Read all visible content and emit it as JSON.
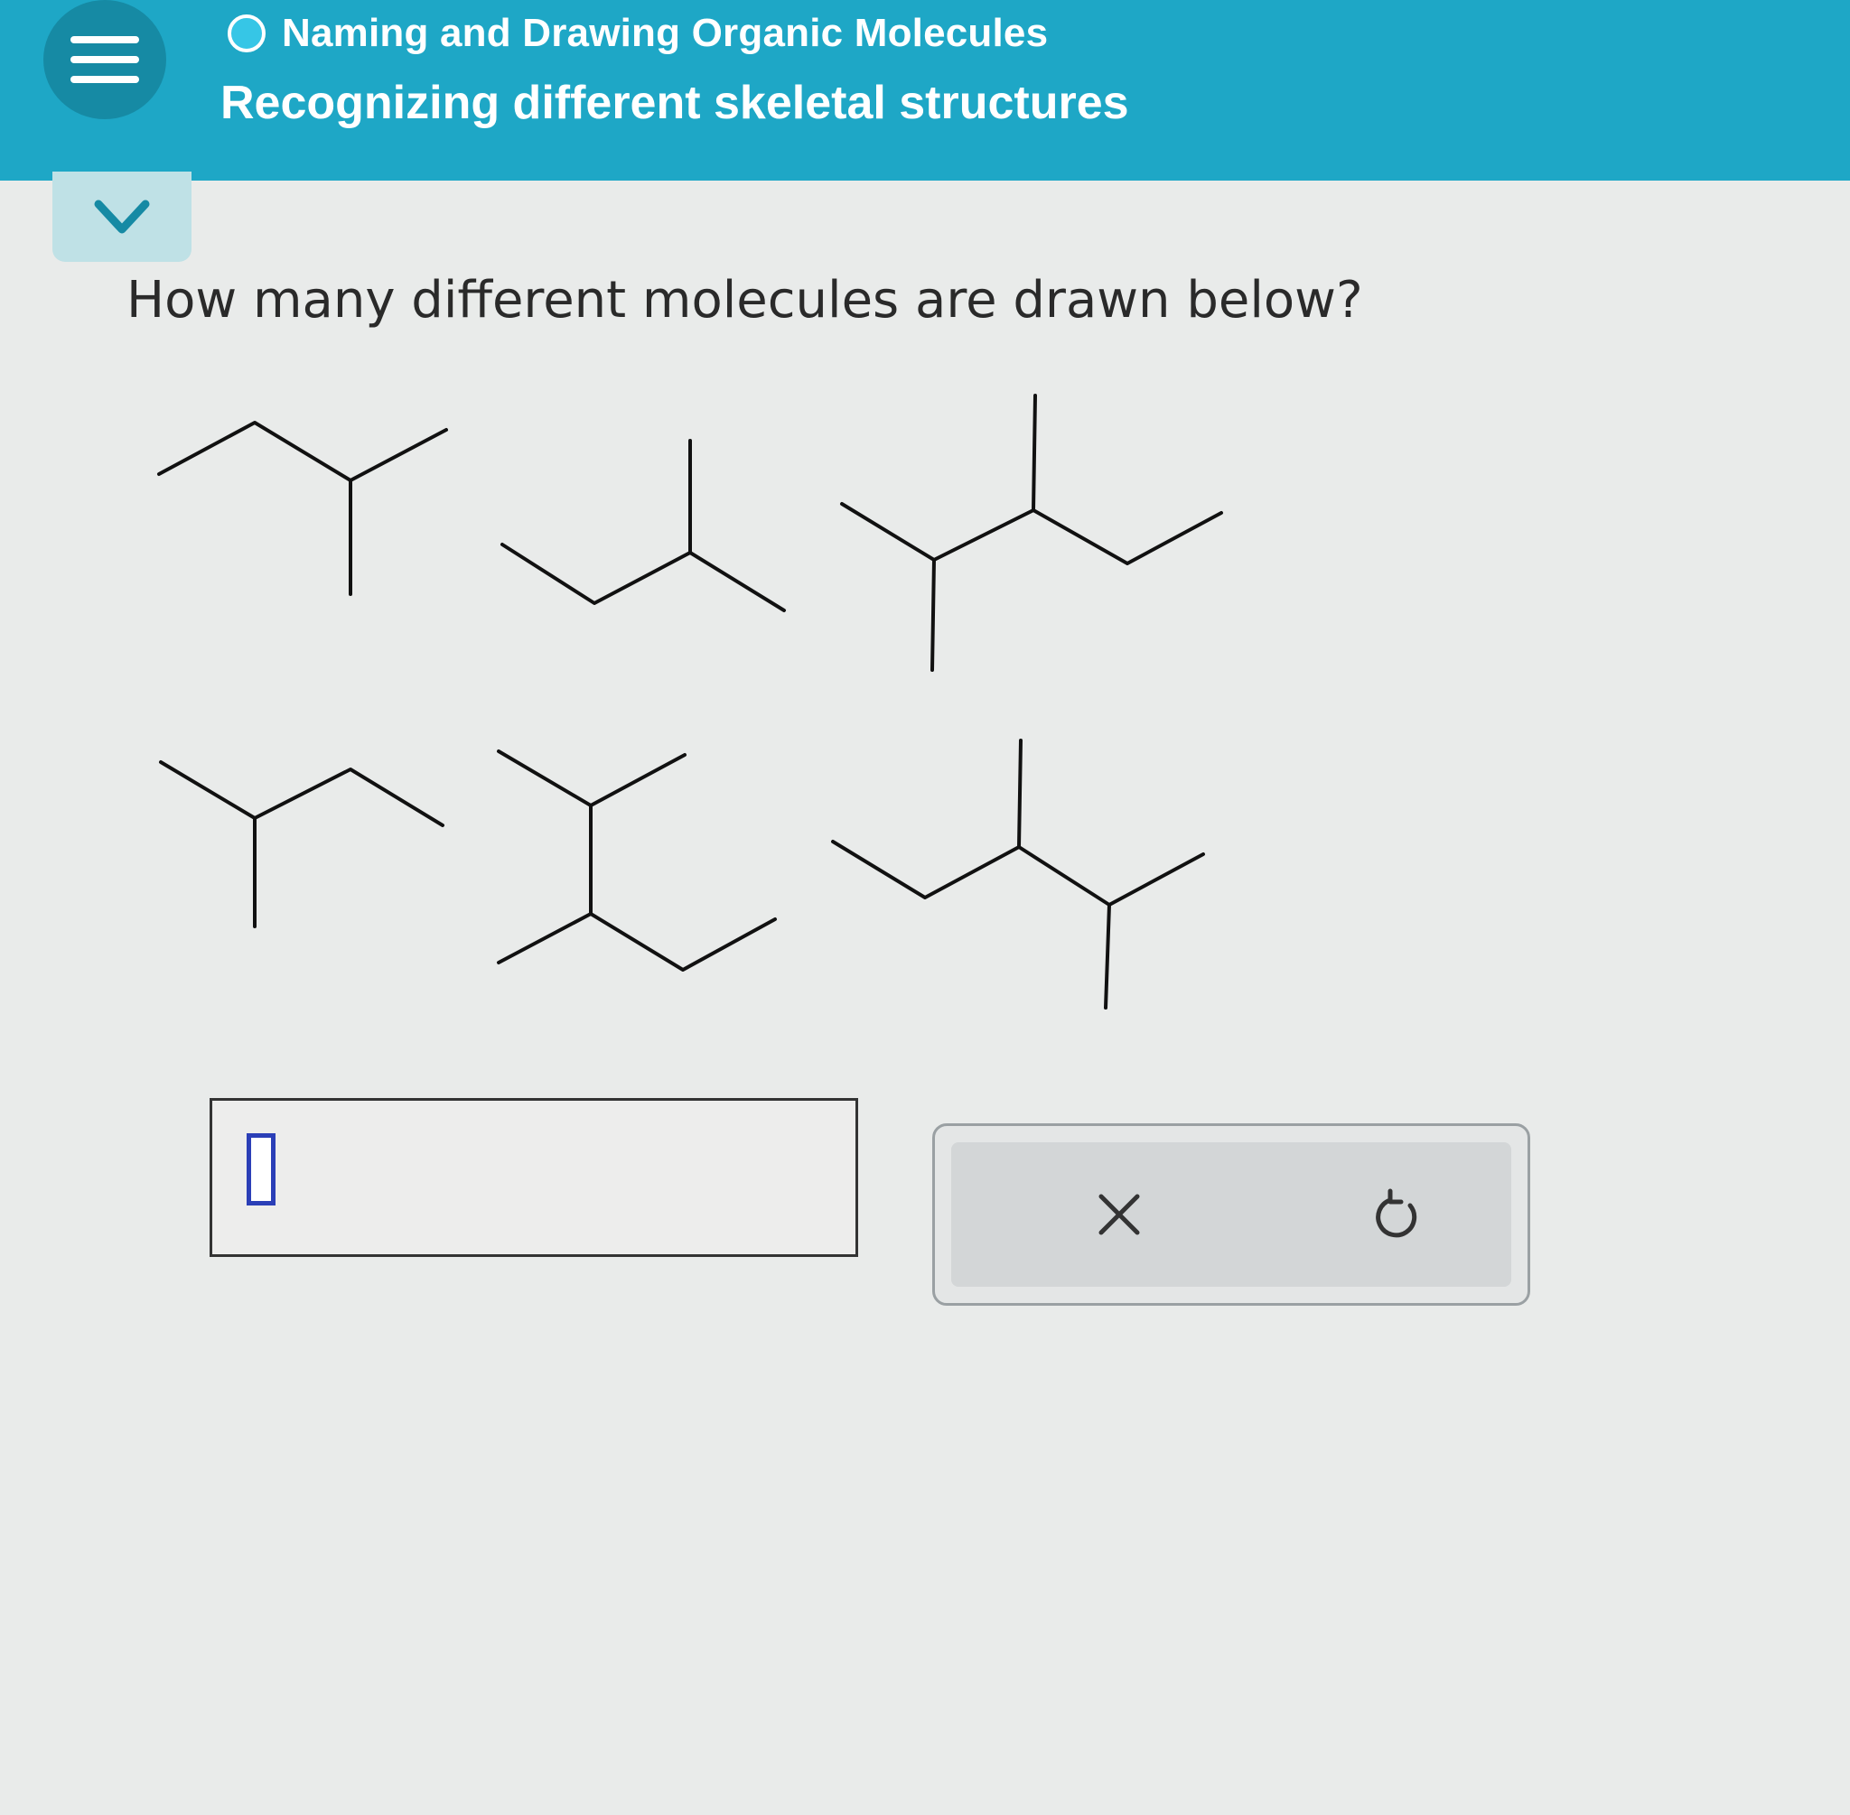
{
  "header": {
    "topic": "Naming and Drawing Organic Molecules",
    "subtopic": "Recognizing different skeletal structures"
  },
  "question": {
    "prompt": "How many different molecules are drawn below?"
  },
  "answer": {
    "value": ""
  },
  "tools": {
    "clear_icon": "x-icon",
    "undo_icon": "undo-icon"
  },
  "colors": {
    "header": "#1ea7c6",
    "accent": "#2b3fb7"
  }
}
